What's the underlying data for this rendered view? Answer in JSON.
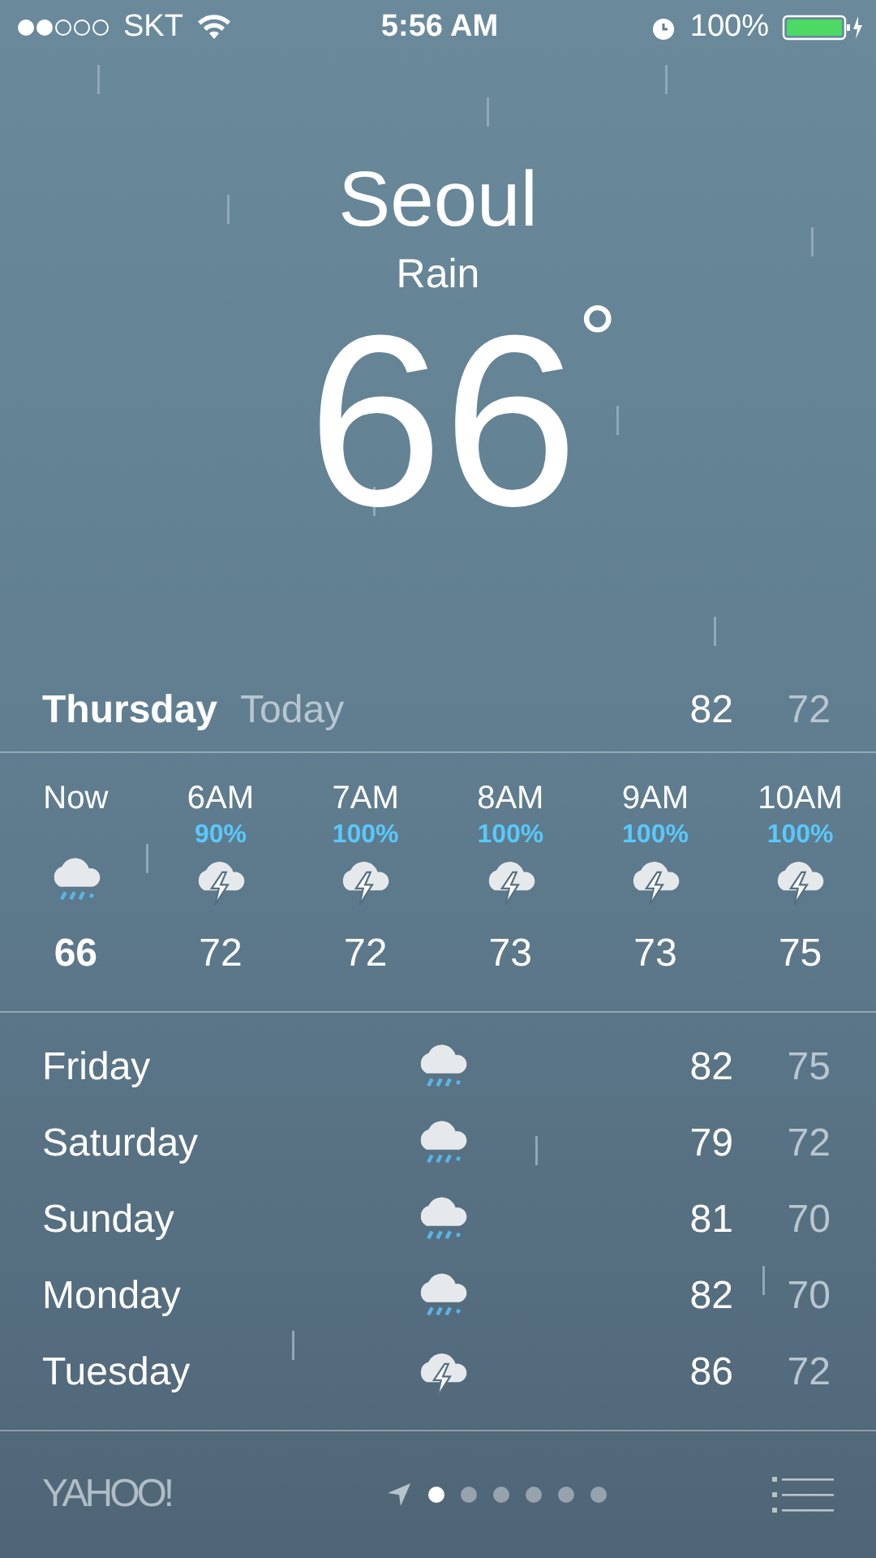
{
  "status_bar": {
    "carrier": "SKT",
    "time": "5:56 AM",
    "battery": "100%"
  },
  "current": {
    "city": "Seoul",
    "condition": "Rain",
    "temperature": "66",
    "degree": "°"
  },
  "today": {
    "day": "Thursday",
    "label": "Today",
    "high": "82",
    "low": "72"
  },
  "hourly": [
    {
      "time": "Now",
      "kind": "rain",
      "temp": "66"
    },
    {
      "time": "6AM",
      "chance": "90%",
      "kind": "thunder",
      "temp": "72"
    },
    {
      "time": "7AM",
      "chance": "100%",
      "kind": "thunder",
      "temp": "72"
    },
    {
      "time": "8AM",
      "chance": "100%",
      "kind": "thunder",
      "temp": "73"
    },
    {
      "time": "9AM",
      "chance": "100%",
      "kind": "thunder",
      "temp": "73"
    },
    {
      "time": "10AM",
      "chance": "100%",
      "kind": "thunder",
      "temp": "75"
    }
  ],
  "daily": [
    {
      "day": "Friday",
      "kind": "rain",
      "high": "82",
      "low": "75"
    },
    {
      "day": "Saturday",
      "kind": "rain",
      "high": "79",
      "low": "72"
    },
    {
      "day": "Sunday",
      "kind": "rain",
      "high": "81",
      "low": "70"
    },
    {
      "day": "Monday",
      "kind": "rain",
      "high": "82",
      "low": "70"
    },
    {
      "day": "Tuesday",
      "kind": "thunder",
      "high": "86",
      "low": "72"
    }
  ],
  "footer": {
    "logo": "YAHOO!",
    "pages": [
      {
        "selected": true
      },
      {
        "selected": false
      },
      {
        "selected": false
      },
      {
        "selected": false
      },
      {
        "selected": false
      },
      {
        "selected": false
      }
    ]
  }
}
